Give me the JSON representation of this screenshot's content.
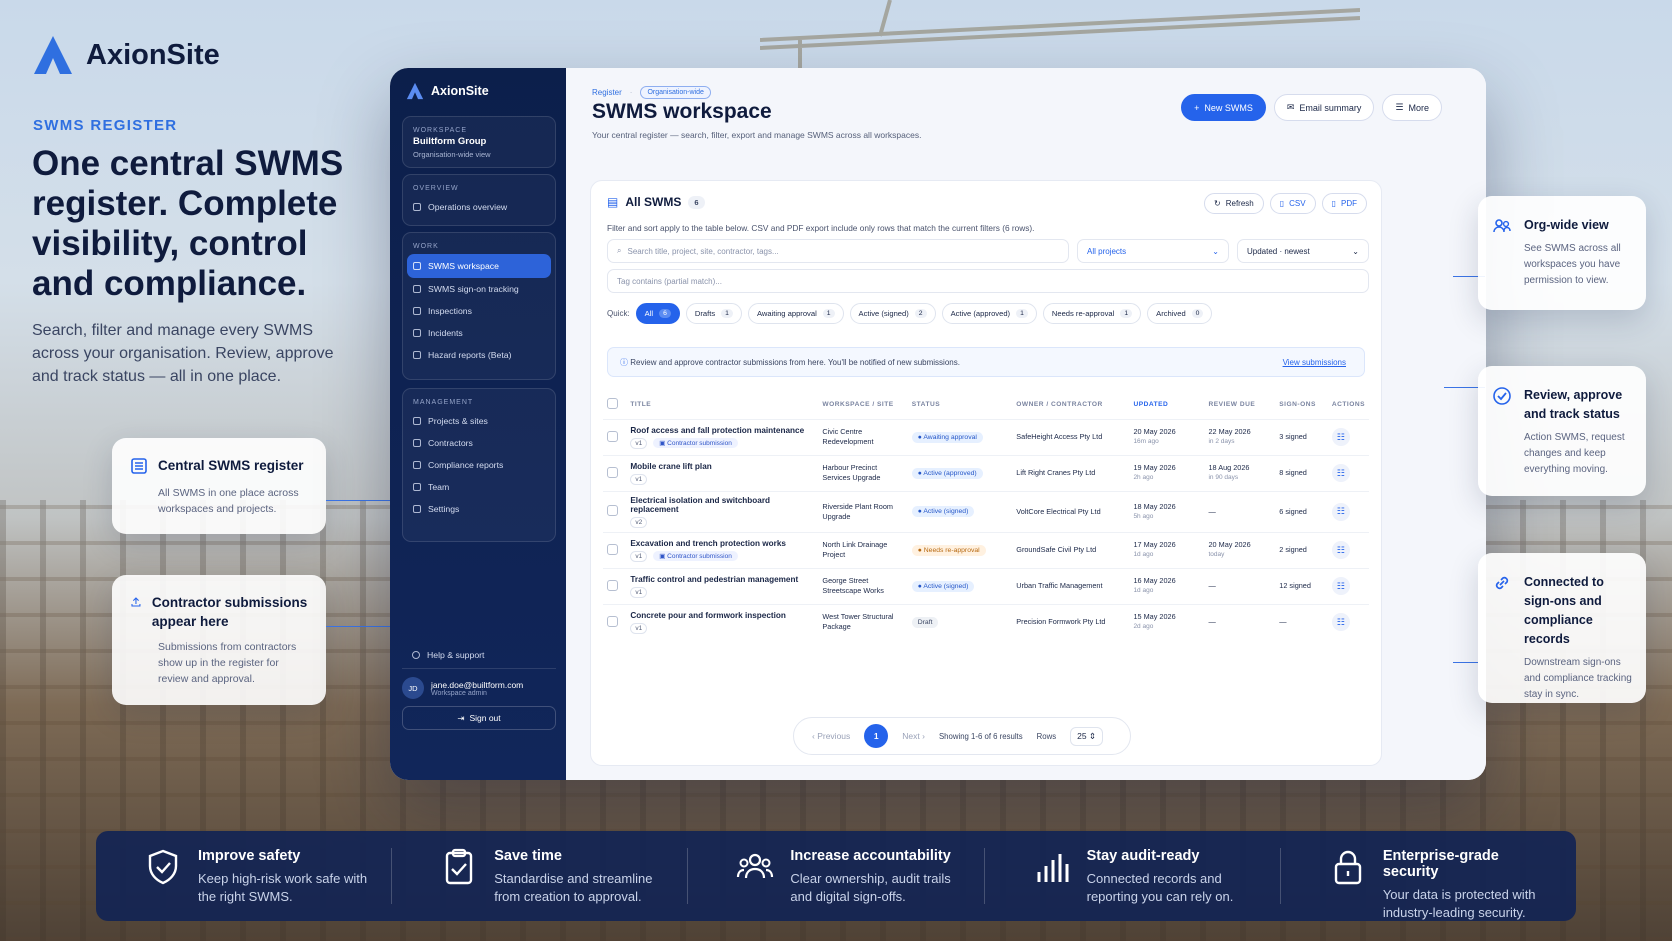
{
  "brand": {
    "name": "AxionSite"
  },
  "hero": {
    "eyebrow": "SWMS REGISTER",
    "title": "One central SWMS register. Complete visibility, control and compliance.",
    "subtitle": "Search, filter and manage every SWMS across your organisation. Review, approve and track status — all in one place."
  },
  "left_cards": [
    {
      "title": "Central SWMS register",
      "text": "All SWMS in one place across workspaces and projects.",
      "icon": "register-icon"
    },
    {
      "title": "Contractor submissions appear here",
      "text": "Submissions from contractors show up in the register for review and approval.",
      "icon": "upload-icon"
    }
  ],
  "sidebar": {
    "brand": "AxionSite",
    "workspace": {
      "label": "WORKSPACE",
      "name": "Builtform Group",
      "desc": "Organisation-wide view"
    },
    "overview": {
      "label": "OVERVIEW",
      "items": [
        "Operations overview"
      ]
    },
    "work": {
      "label": "WORK",
      "items": [
        "SWMS workspace",
        "SWMS sign-on tracking",
        "Inspections",
        "Incidents",
        "Hazard reports (Beta)"
      ]
    },
    "management": {
      "label": "MANAGEMENT",
      "items": [
        "Projects & sites",
        "Contractors",
        "Compliance reports",
        "Team",
        "Settings"
      ]
    },
    "help": "Help & support",
    "user": {
      "initials": "JD",
      "email": "jane.doe@builtform.com",
      "role": "Workspace admin"
    },
    "signout": "Sign out"
  },
  "page": {
    "crumb": "Register",
    "crumb_pill": "Organisation-wide",
    "title": "SWMS workspace",
    "subtitle": "Your central register — search, filter, export and manage SWMS across all workspaces.",
    "btn_new": "New SWMS",
    "btn_email": "Email summary",
    "btn_more": "More"
  },
  "panel": {
    "title": "All SWMS",
    "count": "6",
    "refresh": "Refresh",
    "csv": "CSV",
    "pdf": "PDF",
    "note": "Filter and sort apply to the table below. CSV and PDF export include only rows that match the current filters (6 rows).",
    "search_placeholder": "Search title, project, site, contractor, tags...",
    "projects": "All projects",
    "sort": "Updated · newest",
    "tag_placeholder": "Tag contains (partial match)...",
    "quick_label": "Quick:",
    "chips": [
      {
        "label": "All",
        "n": "6"
      },
      {
        "label": "Drafts",
        "n": "1"
      },
      {
        "label": "Awaiting approval",
        "n": "1"
      },
      {
        "label": "Active (signed)",
        "n": "2"
      },
      {
        "label": "Active (approved)",
        "n": "1"
      },
      {
        "label": "Needs re-approval",
        "n": "1"
      },
      {
        "label": "Archived",
        "n": "0"
      }
    ],
    "info": "Review and approve contractor submissions from here. You'll be notified of new submissions.",
    "info_link": "View submissions",
    "columns": [
      "TITLE",
      "WORKSPACE / SITE",
      "STATUS",
      "OWNER / CONTRACTOR",
      "UPDATED",
      "REVIEW DUE",
      "SIGN-ONS",
      "ACTIONS"
    ],
    "rows": [
      {
        "title": "Roof access and fall protection maintenance",
        "v": "v1",
        "tag": "Contractor submission",
        "site": "Civic Centre Redevelopment",
        "status": "Awaiting approval",
        "owner": "SafeHeight Access Pty Ltd",
        "updated": "20 May 2026",
        "updated_sub": "16m ago",
        "due": "22 May 2026",
        "due_sub": "in 2 days",
        "signons": "3 signed"
      },
      {
        "title": "Mobile crane lift plan",
        "v": "v1",
        "tag": "",
        "site": "Harbour Precinct Services Upgrade",
        "status": "Active (approved)",
        "owner": "Lift Right Cranes Pty Ltd",
        "updated": "19 May 2026",
        "updated_sub": "2h ago",
        "due": "18 Aug 2026",
        "due_sub": "in 90 days",
        "signons": "8 signed"
      },
      {
        "title": "Electrical isolation and switchboard replacement",
        "v": "v2",
        "tag": "",
        "site": "Riverside Plant Room Upgrade",
        "status": "Active (signed)",
        "owner": "VoltCore Electrical Pty Ltd",
        "updated": "18 May 2026",
        "updated_sub": "5h ago",
        "due": "—",
        "due_sub": "",
        "signons": "6 signed"
      },
      {
        "title": "Excavation and trench protection works",
        "v": "v1",
        "tag": "Contractor submission",
        "site": "North Link Drainage Project",
        "status": "Needs re-approval",
        "owner": "GroundSafe Civil Pty Ltd",
        "updated": "17 May 2026",
        "updated_sub": "1d ago",
        "due": "20 May 2026",
        "due_sub": "today",
        "signons": "2 signed"
      },
      {
        "title": "Traffic control and pedestrian management",
        "v": "v1",
        "tag": "",
        "site": "George Street Streetscape Works",
        "status": "Active (signed)",
        "owner": "Urban Traffic Management",
        "updated": "16 May 2026",
        "updated_sub": "1d ago",
        "due": "—",
        "due_sub": "",
        "signons": "12 signed"
      },
      {
        "title": "Concrete pour and formwork inspection",
        "v": "v1",
        "tag": "",
        "site": "West Tower Structural Package",
        "status": "Draft",
        "owner": "Precision Formwork Pty Ltd",
        "updated": "15 May 2026",
        "updated_sub": "2d ago",
        "due": "—",
        "due_sub": "",
        "signons": "—"
      }
    ],
    "pager": {
      "prev": "Previous",
      "page": "1",
      "next": "Next",
      "summary": "Showing 1-6 of 6 results",
      "rows_label": "Rows",
      "rows": "25"
    }
  },
  "right_cards": [
    {
      "title": "Org-wide view",
      "text": "See SWMS across all workspaces you have permission to view.",
      "icon": "users-icon"
    },
    {
      "title": "Review, approve and track status",
      "text": "Action SWMS, request changes and keep everything moving.",
      "icon": "check-circle-icon"
    },
    {
      "title": "Connected to sign-ons and compliance records",
      "text": "Downstream sign-ons and compliance tracking stay in sync.",
      "icon": "link-icon"
    }
  ],
  "benefits": [
    {
      "title": "Improve safety",
      "text": "Keep high-risk work safe with the right SWMS.",
      "icon": "shield-icon"
    },
    {
      "title": "Save time",
      "text": "Standardise and streamline from creation to approval.",
      "icon": "clipboard-icon"
    },
    {
      "title": "Increase accountability",
      "text": "Clear ownership, audit trails and digital sign-offs.",
      "icon": "team-icon"
    },
    {
      "title": "Stay audit-ready",
      "text": "Connected records and reporting you can rely on.",
      "icon": "bars-icon"
    },
    {
      "title": "Enterprise-grade security",
      "text": "Your data is protected with industry-leading security.",
      "icon": "lock-icon"
    }
  ],
  "colors": {
    "accent": "#2563eb",
    "sidebar": "#0c1f4b",
    "awaiting": "#e6f0ff",
    "approved": "#e6f0ff",
    "needs": "#fff1e0",
    "draft": "#eef1f5"
  }
}
